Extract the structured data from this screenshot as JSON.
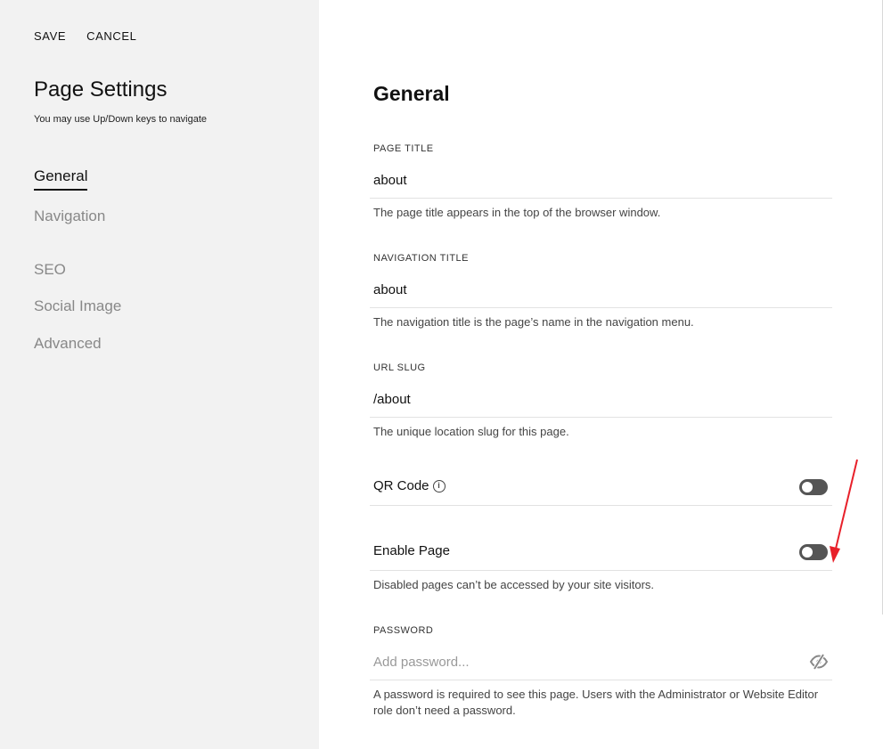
{
  "toolbar": {
    "save_label": "SAVE",
    "cancel_label": "CANCEL"
  },
  "sidebar": {
    "title": "Page Settings",
    "hint": "You may use Up/Down keys to navigate",
    "items": [
      {
        "label": "General",
        "active": true
      },
      {
        "label": "Navigation"
      },
      {
        "label": "SEO"
      },
      {
        "label": "Social Image"
      },
      {
        "label": "Advanced"
      }
    ]
  },
  "main": {
    "title": "General",
    "page_title": {
      "label": "PAGE TITLE",
      "value": "about",
      "help": "The page title appears in the top of the browser window."
    },
    "navigation_title": {
      "label": "NAVIGATION TITLE",
      "value": "about",
      "help": "The navigation title is the page’s name in the navigation menu."
    },
    "url_slug": {
      "label": "URL SLUG",
      "value": "/about",
      "help": "The unique location slug for this page."
    },
    "qr_code": {
      "label": "QR Code",
      "info_icon": "i",
      "enabled": false
    },
    "enable_page": {
      "label": "Enable Page",
      "enabled": false,
      "help": "Disabled pages can’t be accessed by your site visitors."
    },
    "password": {
      "label": "PASSWORD",
      "placeholder": "Add password...",
      "help": "A password is required to see this page. Users with the Administrator or Website Editor role don’t need a password."
    }
  },
  "colors": {
    "sidebar_bg": "#f2f2f2",
    "toggle_off": "#555555",
    "annotation_arrow": "#e8202a"
  },
  "icons": [
    "info-icon",
    "eye-slash-icon",
    "annotation-arrow"
  ]
}
